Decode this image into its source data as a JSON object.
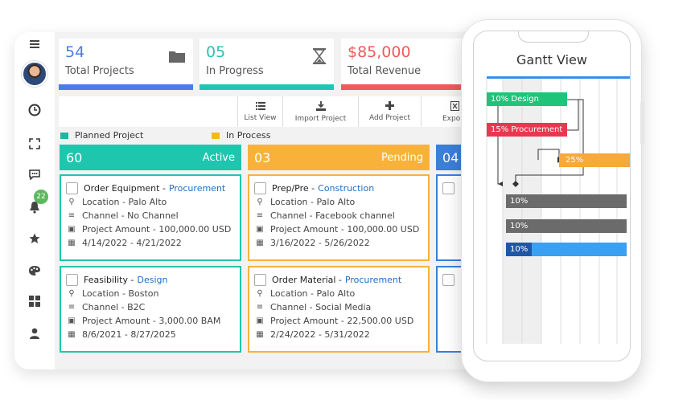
{
  "stats": [
    {
      "value": "54",
      "label": "Total Projects",
      "color": "#4a7de8",
      "icon": "folder-icon"
    },
    {
      "value": "05",
      "label": "In Progress",
      "color": "#22c5b4",
      "icon": "hourglass-icon"
    },
    {
      "value": "$85,000",
      "label": "Total Revenue",
      "color": "#ef5a5a",
      "icon": ""
    }
  ],
  "toolbar": {
    "list_view": "List View",
    "import_project": "Import Project",
    "add_project": "Add Project",
    "export": "Export to"
  },
  "legend": {
    "planned": "Planned Project",
    "in_process": "In Process",
    "planned_color": "#22b5a0",
    "in_process_color": "#f5b820"
  },
  "columns": [
    {
      "count": "60",
      "status": "Active",
      "color": "#1fc6ae"
    },
    {
      "count": "03",
      "status": "Pending",
      "color": "#f8b23a"
    },
    {
      "count": "04",
      "status": "",
      "color": "#3b7fd9"
    }
  ],
  "cards": [
    {
      "name": "Order Equipment -",
      "category": "Procurement",
      "location": "Location - Palo Alto",
      "channel": "Channel - No Channel",
      "amount": "Project Amount - 100,000.00 USD",
      "dates": "4/14/2022 - 4/21/2022"
    },
    {
      "name": "Prep/Pre -",
      "category": "Construction",
      "location": "Location - Palo Alto",
      "channel": "Channel - Facebook channel",
      "amount": "Project Amount - 100,000.00 USD",
      "dates": "3/16/2022 - 5/26/2022"
    },
    {
      "name": "Feasibility -",
      "category": "Design",
      "location": "Location - Boston",
      "channel": "Channel - B2C",
      "amount": "Project Amount - 3,000.00 BAM",
      "dates": "8/6/2021 - 8/27/2025"
    },
    {
      "name": "Order Material -",
      "category": "Procurement",
      "location": "Location - Palo Alto",
      "channel": "Channel - Social Media",
      "amount": "Project Amount - 22,500.00 USD",
      "dates": "2/24/2022 - 5/31/2022"
    }
  ],
  "sidebar": {
    "notification_count": "22"
  },
  "gantt": {
    "title": "Gantt View",
    "bars": [
      {
        "label": "10%  Design",
        "color": "#1fc47a"
      },
      {
        "label": "15% Procurement",
        "color": "#e8384f"
      },
      {
        "label": "25%",
        "color": "#f7a93a"
      },
      {
        "label": "10%",
        "color": "#6b6b6b"
      },
      {
        "label": "10%",
        "color": "#6b6b6b"
      },
      {
        "label": "10%",
        "color": "#3aa0f2"
      }
    ]
  }
}
